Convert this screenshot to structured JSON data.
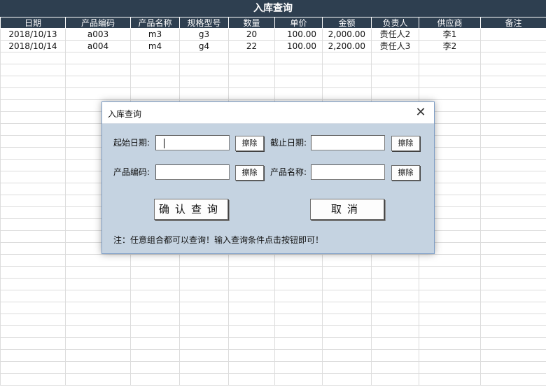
{
  "sheet": {
    "title": "入库查询",
    "headers": [
      "日期",
      "产品编码",
      "产品名称",
      "规格型号",
      "数量",
      "单价",
      "金额",
      "负责人",
      "供应商",
      "备注"
    ],
    "rows": [
      [
        "2018/10/13",
        "a003",
        "m3",
        "g3",
        "20",
        "100.00",
        "2,000.00",
        "责任人2",
        "李1",
        ""
      ],
      [
        "2018/10/14",
        "a004",
        "m4",
        "g4",
        "22",
        "100.00",
        "2,200.00",
        "责任人3",
        "李2",
        ""
      ]
    ]
  },
  "dialog": {
    "title": "入库查询",
    "close_glyph": "✕",
    "start_date_label": "起始日期:",
    "start_date_value": "",
    "end_date_label": "截止日期:",
    "end_date_value": "",
    "product_code_label": "产品编码:",
    "product_code_value": "",
    "product_name_label": "产品名称:",
    "product_name_value": "",
    "clear_label": "擦除",
    "confirm_label": "确认查询",
    "cancel_label": "取消",
    "note": "注：任意组合都可以查询！输入查询条件点击按钮即可！"
  }
}
